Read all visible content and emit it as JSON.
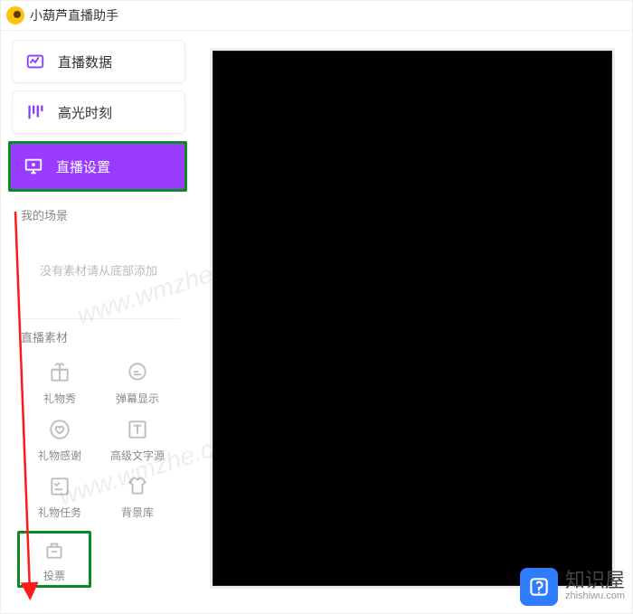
{
  "app": {
    "title": "小葫芦直播助手"
  },
  "sidebar": {
    "items": [
      {
        "label": "直播数据"
      },
      {
        "label": "高光时刻"
      }
    ],
    "active": {
      "label": "直播设置"
    }
  },
  "scene": {
    "section_label": "我的场景",
    "empty_hint": "没有素材请从底部添加"
  },
  "assets": {
    "section_label": "直播素材",
    "tools": [
      {
        "label": "礼物秀"
      },
      {
        "label": "弹幕显示"
      },
      {
        "label": "礼物感谢"
      },
      {
        "label": "高级文字源"
      },
      {
        "label": "礼物任务"
      },
      {
        "label": "背景库"
      },
      {
        "label": "投票"
      }
    ]
  },
  "watermark": {
    "text": "www.wmzhe.com"
  },
  "brand": {
    "name": "知识屋",
    "domain": "zhishiwu.com"
  }
}
